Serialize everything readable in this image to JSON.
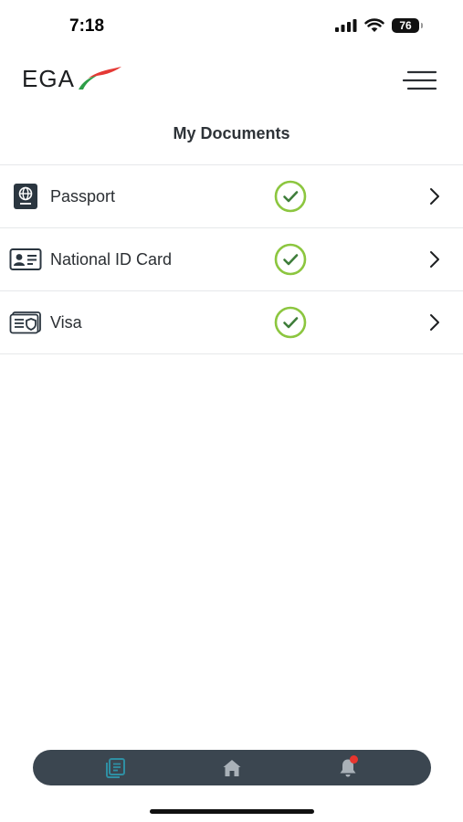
{
  "status_bar": {
    "time": "7:18",
    "battery": "76"
  },
  "header": {
    "logo_text": "EGA",
    "page_title": "My Documents"
  },
  "documents": [
    {
      "label": "Passport",
      "icon": "passport-icon",
      "verified": true
    },
    {
      "label": "National ID Card",
      "icon": "id-card-icon",
      "verified": true
    },
    {
      "label": "Visa",
      "icon": "visa-icon",
      "verified": true
    }
  ],
  "bottom_nav": {
    "items": [
      {
        "icon": "documents-icon",
        "active": true
      },
      {
        "icon": "home-icon",
        "active": false
      },
      {
        "icon": "bell-icon",
        "active": false,
        "has_notification": true
      }
    ]
  },
  "colors": {
    "check_green": "#8cc63f",
    "nav_bg": "#3b4650",
    "nav_active": "#2f8fa3",
    "nav_inactive": "#a9b1b8",
    "notification": "#e8352e",
    "logo_red": "#e53935",
    "logo_green": "#2e9e48"
  }
}
